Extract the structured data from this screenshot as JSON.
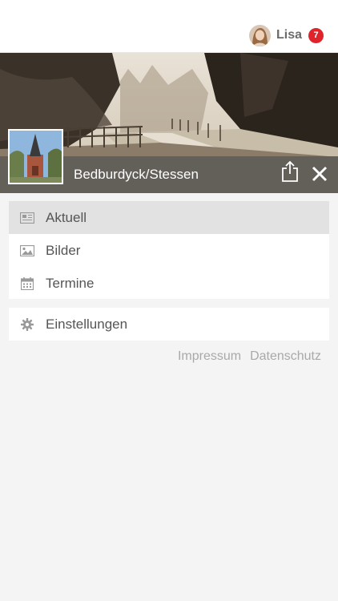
{
  "user": {
    "name": "Lisa",
    "notifications": "7"
  },
  "location": {
    "name": "Bedburdyck/Stessen"
  },
  "menu": {
    "primary": [
      {
        "label": "Aktuell",
        "icon": "newspaper-icon",
        "active": true
      },
      {
        "label": "Bilder",
        "icon": "image-icon",
        "active": false
      },
      {
        "label": "Termine",
        "icon": "calendar-icon",
        "active": false
      }
    ],
    "secondary": [
      {
        "label": "Einstellungen",
        "icon": "gear-icon"
      }
    ]
  },
  "footer": {
    "impressum": "Impressum",
    "datenschutz": "Datenschutz"
  },
  "colors": {
    "badge": "#e0242c",
    "active_item": "#e2e2e2",
    "hero_bar": "#5f5c58"
  }
}
